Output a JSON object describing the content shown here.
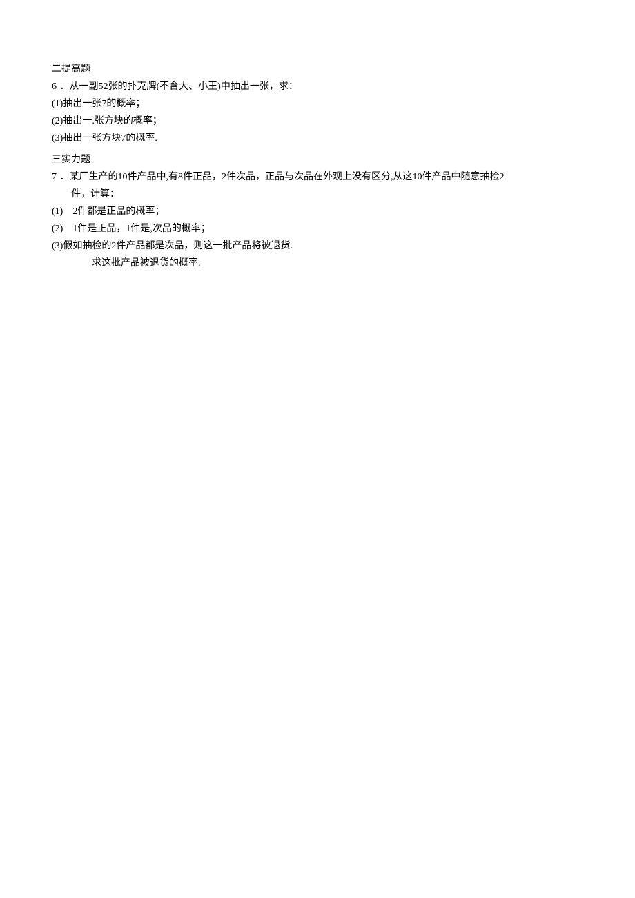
{
  "section1": {
    "title": "二提高题",
    "q6": {
      "num": "6",
      "stem": "．从一副52张的扑克牌(不含大、小王)中抽出一张，求：",
      "p1": "(1)抽出一张7的概率；",
      "p2": "(2)抽出一.张方块的概率；",
      "p3": "(3)抽出一张方块7的概率."
    }
  },
  "section2": {
    "title": "三实力题",
    "q7": {
      "num": "7",
      "stem": "．某厂生产的10件产品中,有8件正品，2件次品，正品与次品在外观上没有区分,从这10件产品中随意抽检2",
      "stem2": "件，计算：",
      "p1": "(1)　2件都是正品的概率；",
      "p2": "(2)　1件是正品，1件是,次品的概率；",
      "p3": "(3)假如抽检的2件产品都是次品，则这一批产品将被退货.",
      "p3b": "求这批产品被退货的概率."
    }
  }
}
